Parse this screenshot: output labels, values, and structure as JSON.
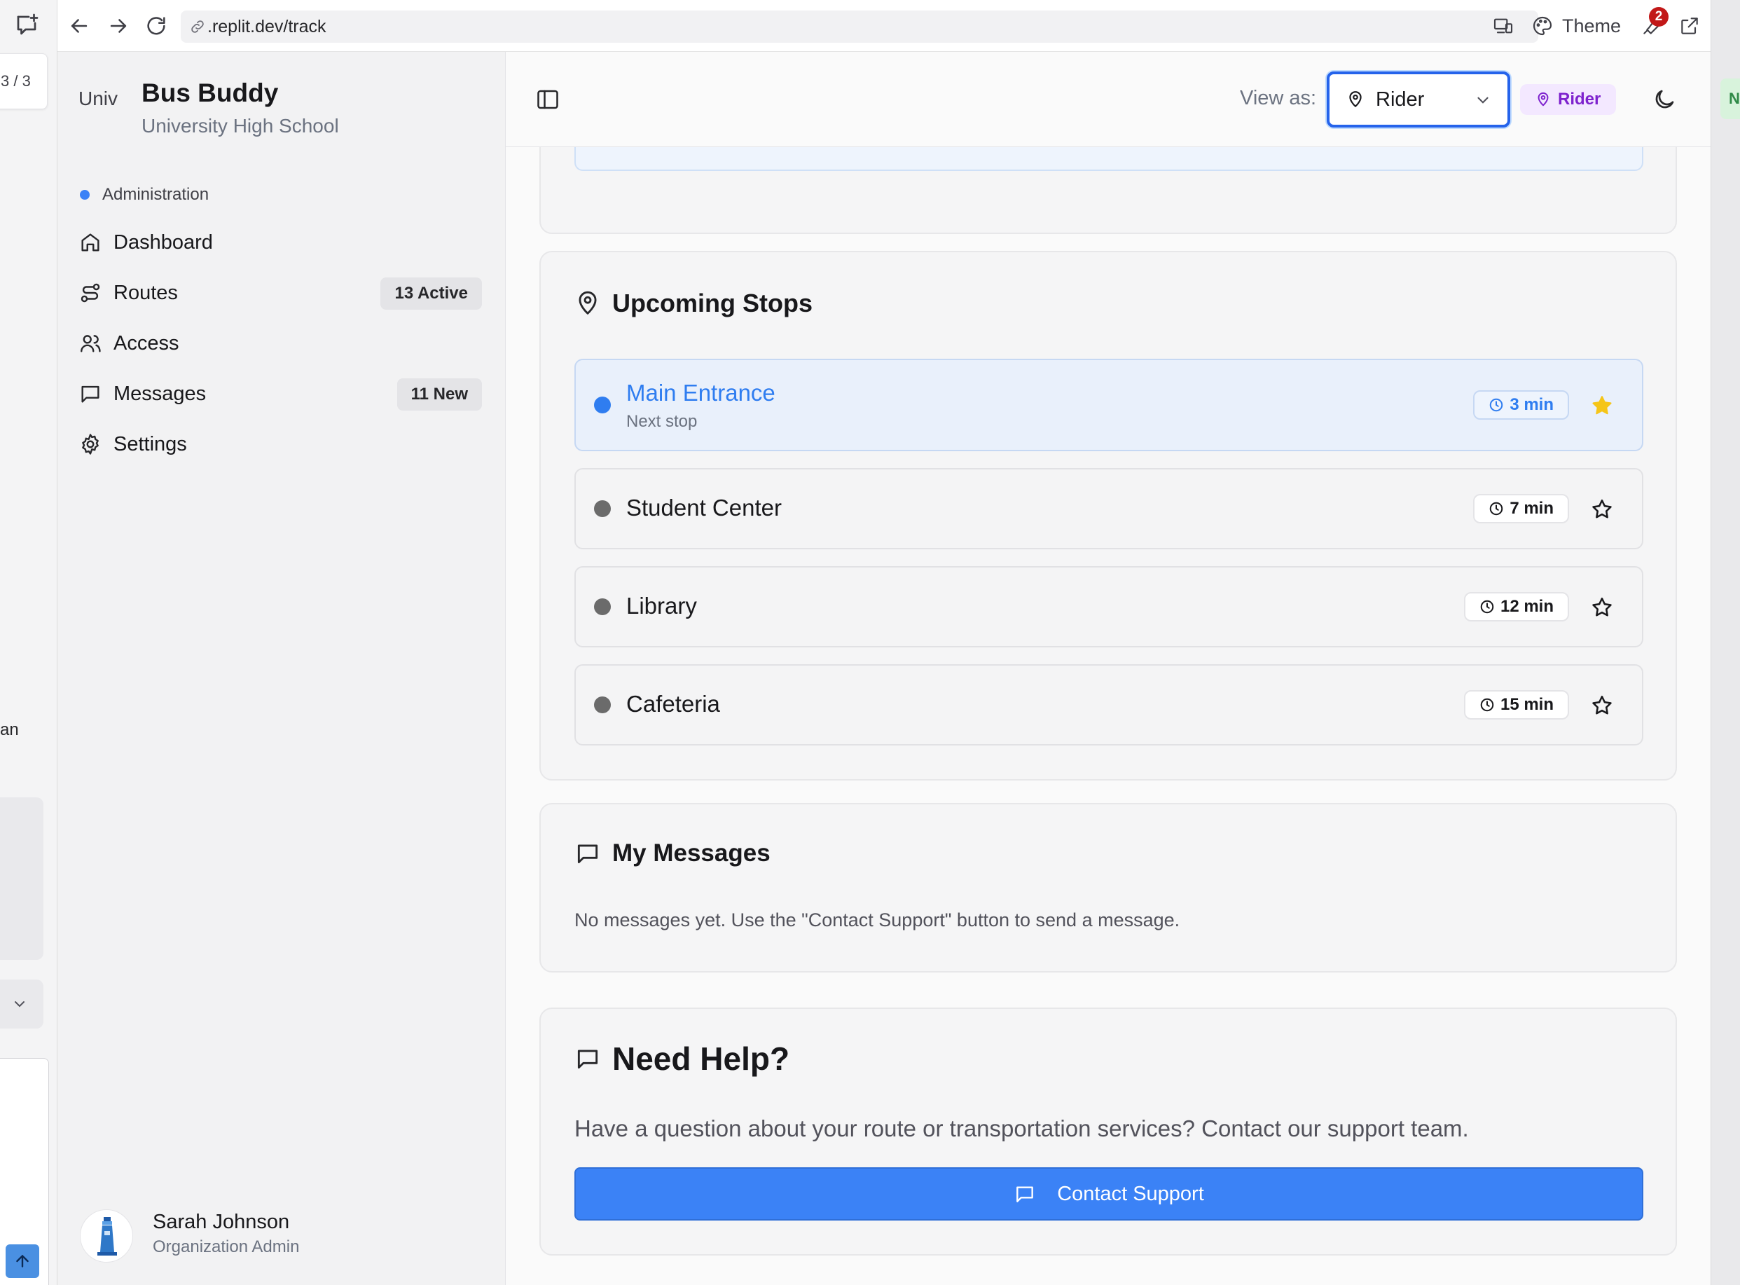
{
  "browser": {
    "url_prefix": ".replit.dev",
    "url_path": "/track",
    "theme_label": "Theme",
    "notification_count": "2"
  },
  "outer": {
    "page_counter": "3 / 3",
    "truncated_text": "an",
    "right_tag": "N"
  },
  "sidebar": {
    "brand_title": "Bus Buddy",
    "brand_logo_alt": "Univ",
    "brand_subtitle": "University High School",
    "section_label": "Administration",
    "items": [
      {
        "label": "Dashboard",
        "icon": "home-icon",
        "badge": ""
      },
      {
        "label": "Routes",
        "icon": "route-icon",
        "badge": "13 Active"
      },
      {
        "label": "Access",
        "icon": "users-icon",
        "badge": ""
      },
      {
        "label": "Messages",
        "icon": "message-icon",
        "badge": "11 New"
      },
      {
        "label": "Settings",
        "icon": "gear-icon",
        "badge": ""
      }
    ],
    "user": {
      "name": "Sarah Johnson",
      "role": "Organization Admin"
    }
  },
  "header": {
    "view_as_label": "View as:",
    "selected_role": "Rider",
    "role_badge": "Rider"
  },
  "stops_card": {
    "title": "Upcoming Stops",
    "stops": [
      {
        "name": "Main Entrance",
        "sub": "Next stop",
        "eta": "3 min",
        "favorite": true,
        "active": true
      },
      {
        "name": "Student Center",
        "sub": "",
        "eta": "7 min",
        "favorite": false,
        "active": false
      },
      {
        "name": "Library",
        "sub": "",
        "eta": "12 min",
        "favorite": false,
        "active": false
      },
      {
        "name": "Cafeteria",
        "sub": "",
        "eta": "15 min",
        "favorite": false,
        "active": false
      }
    ]
  },
  "messages_card": {
    "title": "My Messages",
    "empty_text": "No messages yet. Use the \"Contact Support\" button to send a message."
  },
  "help_card": {
    "title": "Need Help?",
    "text": "Have a question about your route or transportation services? Contact our support team.",
    "button_label": "Contact Support"
  },
  "colors": {
    "accent": "#3b82f6",
    "active_stop": "#2f7df0",
    "favorite_star": "#f5c518",
    "role_badge_bg": "#f3e8ff",
    "role_badge_fg": "#7e22ce"
  }
}
